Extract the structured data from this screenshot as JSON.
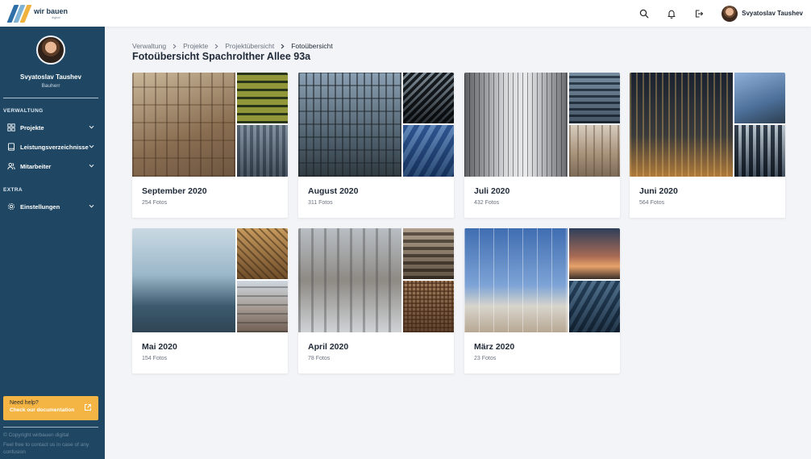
{
  "header": {
    "logo_text": "wir bauen",
    "logo_sub": "digital",
    "user_name": "Svyatoslav Taushev",
    "icons": [
      "search-icon",
      "bell-icon",
      "logout-icon"
    ]
  },
  "sidebar": {
    "user_name": "Svyatoslav Taushev",
    "user_role": "Bauherr",
    "section_1": "VERWALTUNG",
    "section_2": "EXTRA",
    "items": [
      {
        "label": "Projekte",
        "icon": "grid-icon"
      },
      {
        "label": "Leistungsverzeichnisse",
        "icon": "book-icon"
      },
      {
        "label": "Mitarbeiter",
        "icon": "users-icon"
      },
      {
        "label": "Einstellungen",
        "icon": "gear-icon"
      }
    ],
    "help": {
      "title": "Need help?",
      "link": "Check our documentation"
    },
    "footer": {
      "copyright": "© Copyright wirbauen digital",
      "note": "Feel free to contact us in case of any confusion"
    }
  },
  "breadcrumb": [
    "Verwaltung",
    "Projekte",
    "Projektübersicht",
    "Fotoübersicht"
  ],
  "page_title": "Fotoübersicht Spachrolther Allee 93a",
  "albums": [
    {
      "title": "September 2020",
      "count": "254 Fotos"
    },
    {
      "title": "August 2020",
      "count": "311 Fotos"
    },
    {
      "title": "Juli 2020",
      "count": "432 Fotos"
    },
    {
      "title": "Juni 2020",
      "count": "564 Fotos"
    },
    {
      "title": "Mai 2020",
      "count": "154 Fotos"
    },
    {
      "title": "April 2020",
      "count": "78 Fotos"
    },
    {
      "title": "März 2020",
      "count": "23 Fotos"
    }
  ],
  "colors": {
    "sidebar": "#1f4763",
    "accent": "#f4b545",
    "background": "#f2f4f7"
  }
}
